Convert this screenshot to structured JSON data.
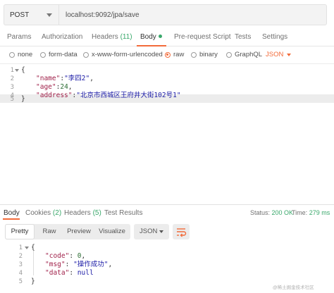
{
  "request": {
    "method": "POST",
    "url": "localhost:9092/jpa/save"
  },
  "request_tabs": [
    {
      "label": "Params"
    },
    {
      "label": "Authorization"
    },
    {
      "label": "Headers",
      "count": "(11)"
    },
    {
      "label": "Body"
    },
    {
      "label": "Pre-request Script"
    },
    {
      "label": "Tests"
    },
    {
      "label": "Settings"
    }
  ],
  "body_types": [
    {
      "label": "none"
    },
    {
      "label": "form-data"
    },
    {
      "label": "x-www-form-urlencoded"
    },
    {
      "label": "raw"
    },
    {
      "label": "binary"
    },
    {
      "label": "GraphQL"
    }
  ],
  "body_format": "JSON",
  "request_body": {
    "line_numbers": [
      "1",
      "2",
      "3",
      "4",
      "5"
    ],
    "open_brace": "{",
    "close_brace": "}",
    "fields": [
      {
        "key": "\"name\"",
        "sep": ":",
        "value": "\"李四2\"",
        "trail": ","
      },
      {
        "key": "\"age\"",
        "sep": ":",
        "value": "24",
        "trail": ","
      },
      {
        "key": "\"address\"",
        "sep": ":",
        "value": "\"北京市西城区王府井大街102号1\"",
        "trail": ""
      }
    ]
  },
  "response_tabs": [
    {
      "label": "Body"
    },
    {
      "label": "Cookies",
      "count": "(2)"
    },
    {
      "label": "Headers",
      "count": "(5)"
    },
    {
      "label": "Test Results"
    }
  ],
  "response_status": {
    "status_label": "Status:",
    "status_value": "200 OK",
    "time_label": "Time:",
    "time_value": "279 ms"
  },
  "view_modes": [
    {
      "label": "Pretty"
    },
    {
      "label": "Raw"
    },
    {
      "label": "Preview"
    },
    {
      "label": "Visualize"
    }
  ],
  "response_format": "JSON",
  "response_body": {
    "line_numbers": [
      "1",
      "2",
      "3",
      "4",
      "5"
    ],
    "open_brace": "{",
    "close_brace": "}",
    "fields": [
      {
        "key": "\"code\"",
        "sep": ": ",
        "value": "0",
        "trail": ","
      },
      {
        "key": "\"msg\"",
        "sep": ": ",
        "value": "\"操作成功\"",
        "trail": ","
      },
      {
        "key": "\"data\"",
        "sep": ": ",
        "value": "null",
        "trail": ""
      }
    ]
  },
  "watermark": "@稀土掘金技术社区",
  "colors": {
    "accent": "#f26b3a",
    "success": "#39a86b",
    "json_key": "#a1224b",
    "json_string": "#1a1aa6",
    "json_number": "#2d6e34"
  }
}
